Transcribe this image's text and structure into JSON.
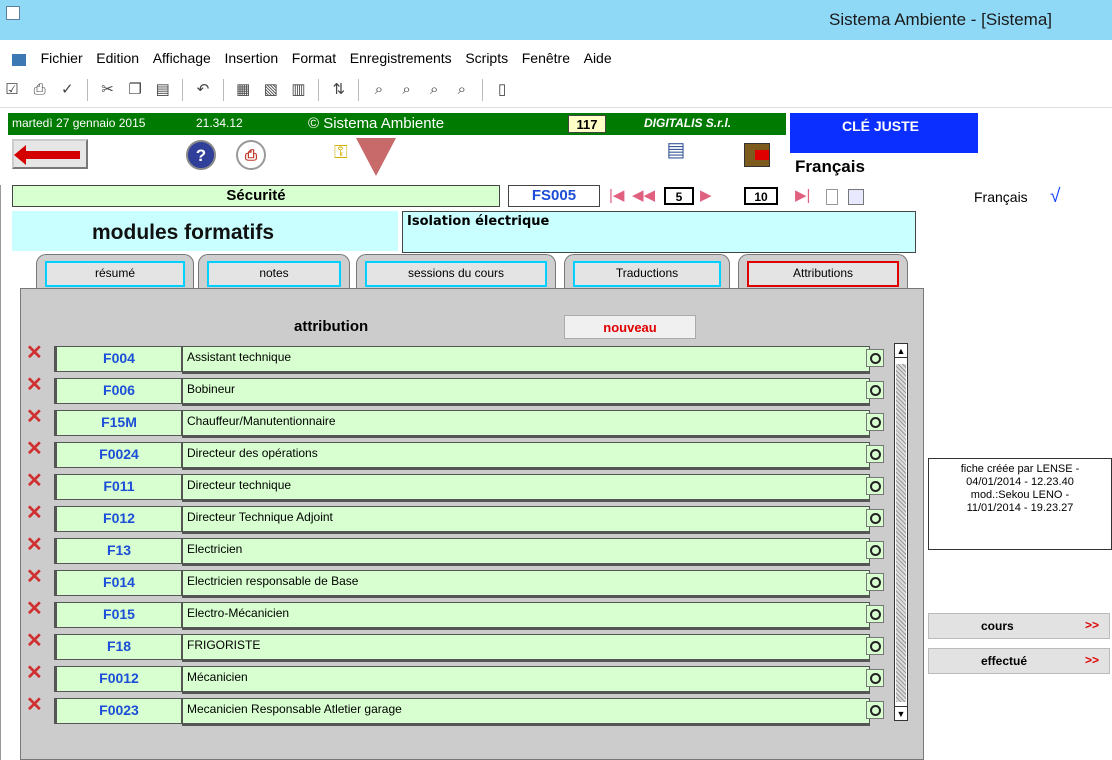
{
  "window": {
    "title": "Sistema Ambiente - [Sistema]"
  },
  "menu": [
    "Fichier",
    "Edition",
    "Affichage",
    "Insertion",
    "Format",
    "Enregistrements",
    "Scripts",
    "Fenêtre",
    "Aide"
  ],
  "status_bar": {
    "date": "martedì 27 gennaio 2015",
    "time": "21.34.12",
    "copyright": "© Sistema Ambiente",
    "count": "117",
    "company": "DIGITALIS S.r.l.",
    "key_label": "CLÉ JUSTE"
  },
  "language": {
    "current": "Français",
    "selector": "Français"
  },
  "record": {
    "category": "Sécurité",
    "code": "FS005",
    "current": "5",
    "total": "10"
  },
  "module": {
    "title": "modules formatifs",
    "description": "Isolation électrique"
  },
  "tabs": [
    "résumé",
    "notes",
    "sessions du cours",
    "Traductions",
    "Attributions"
  ],
  "attribution": {
    "heading": "attribution",
    "new_label": "nouveau",
    "rows": [
      {
        "code": "F004",
        "label": "Assistant technique"
      },
      {
        "code": "F006",
        "label": "Bobineur"
      },
      {
        "code": "F15M",
        "label": "Chauffeur/Manutentionnaire"
      },
      {
        "code": "F0024",
        "label": "Directeur des opérations"
      },
      {
        "code": "F011",
        "label": "Directeur technique"
      },
      {
        "code": "F012",
        "label": "Directeur Technique Adjoint"
      },
      {
        "code": "F13",
        "label": "Electricien"
      },
      {
        "code": "F014",
        "label": "Electricien responsable de  Base"
      },
      {
        "code": "F015",
        "label": "Electro-Mécanicien"
      },
      {
        "code": "F18",
        "label": "FRIGORISTE"
      },
      {
        "code": "F0012",
        "label": "Mécanicien"
      },
      {
        "code": "F0023",
        "label": "Mecanicien Responsable Atletier garage"
      }
    ]
  },
  "side": {
    "info": [
      "fiche créée par LENSE -",
      "04/01/2014 - 12.23.40",
      "mod.:Sekou LENO -",
      "11/01/2014 - 19.23.27"
    ],
    "btn_cours": "cours",
    "btn_effectue": "effectué",
    "arrow": ">>"
  },
  "colors": {
    "green_bar": "#007a00",
    "key_box": "#0b2fff",
    "field_green": "#d7ffcf",
    "field_cyan": "#c9ffff"
  }
}
